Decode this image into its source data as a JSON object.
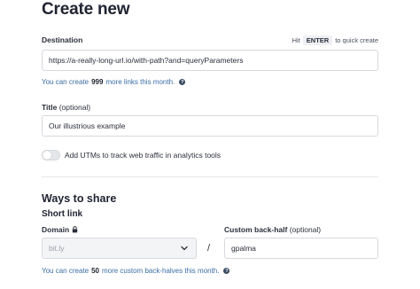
{
  "page_title": "Create new",
  "destination": {
    "label": "Destination",
    "hint_prefix": "Hit",
    "hint_key": "ENTER",
    "hint_suffix": "to quick create",
    "value": "https://a-really-long-url.io/with-path?and=queryParameters",
    "limit_prefix": "You can create",
    "limit_count": "999",
    "limit_suffix": "more links this month."
  },
  "title_field": {
    "label": "Title",
    "label_optional": "(optional)",
    "value": "Our illustrious example"
  },
  "utm": {
    "label": "Add UTMs to track web traffic in analytics tools",
    "enabled": false
  },
  "ways_to_share": {
    "heading": "Ways to share",
    "short_link_heading": "Short link",
    "domain_label": "Domain",
    "domain_value": "bit.ly",
    "separator": "/",
    "back_half_label": "Custom back-half",
    "back_half_optional": "(optional)",
    "back_half_value": "gpalma",
    "limit_prefix": "You can create",
    "limit_count": "50",
    "limit_suffix": "more custom back-halves this month."
  },
  "colors": {
    "link_blue": "#3b6ea5",
    "text_dark": "#202432",
    "border": "#d6d9de"
  },
  "icons": [
    "help-circle-icon",
    "lock-icon",
    "chevron-down-icon"
  ]
}
